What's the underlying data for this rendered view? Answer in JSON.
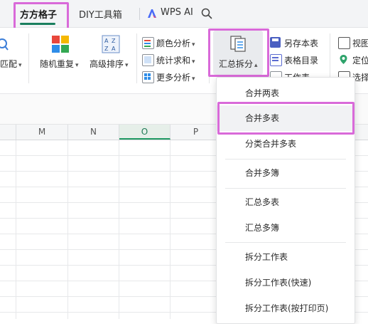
{
  "tabs": {
    "active": "方方格子",
    "diy": "DIY工具箱",
    "wps_ai": "WPS AI"
  },
  "ribbon": {
    "partial_left": "匹配",
    "random_repeat": "随机重复",
    "advanced_sort": "高级排序",
    "color_analysis": "颜色分析",
    "count_sum": "统计求和",
    "more_analysis": "更多分析",
    "summarize_split": "汇总拆分",
    "save_as_sheet": "另存本表",
    "sheet_catalog": "表格目录",
    "worksheet_partial": "工作表",
    "view_partial": "视图",
    "locate_partial": "定位",
    "select_partial": "选择"
  },
  "columns": [
    "M",
    "N",
    "O",
    "P"
  ],
  "selected_column": "O",
  "menu": {
    "items": [
      "合并两表",
      "合并多表",
      "分类合并多表",
      "合并多簿",
      "汇总多表",
      "汇总多簿",
      "拆分工作表",
      "拆分工作表(快速)",
      "拆分工作表(按打印页)"
    ],
    "hovered_index": 1
  },
  "icons": {
    "search": "search-icon",
    "wps_ai": "wps-ai-logo-icon"
  },
  "colors": {
    "accent": "#1a7f5e",
    "highlight": "#d96ad9"
  }
}
